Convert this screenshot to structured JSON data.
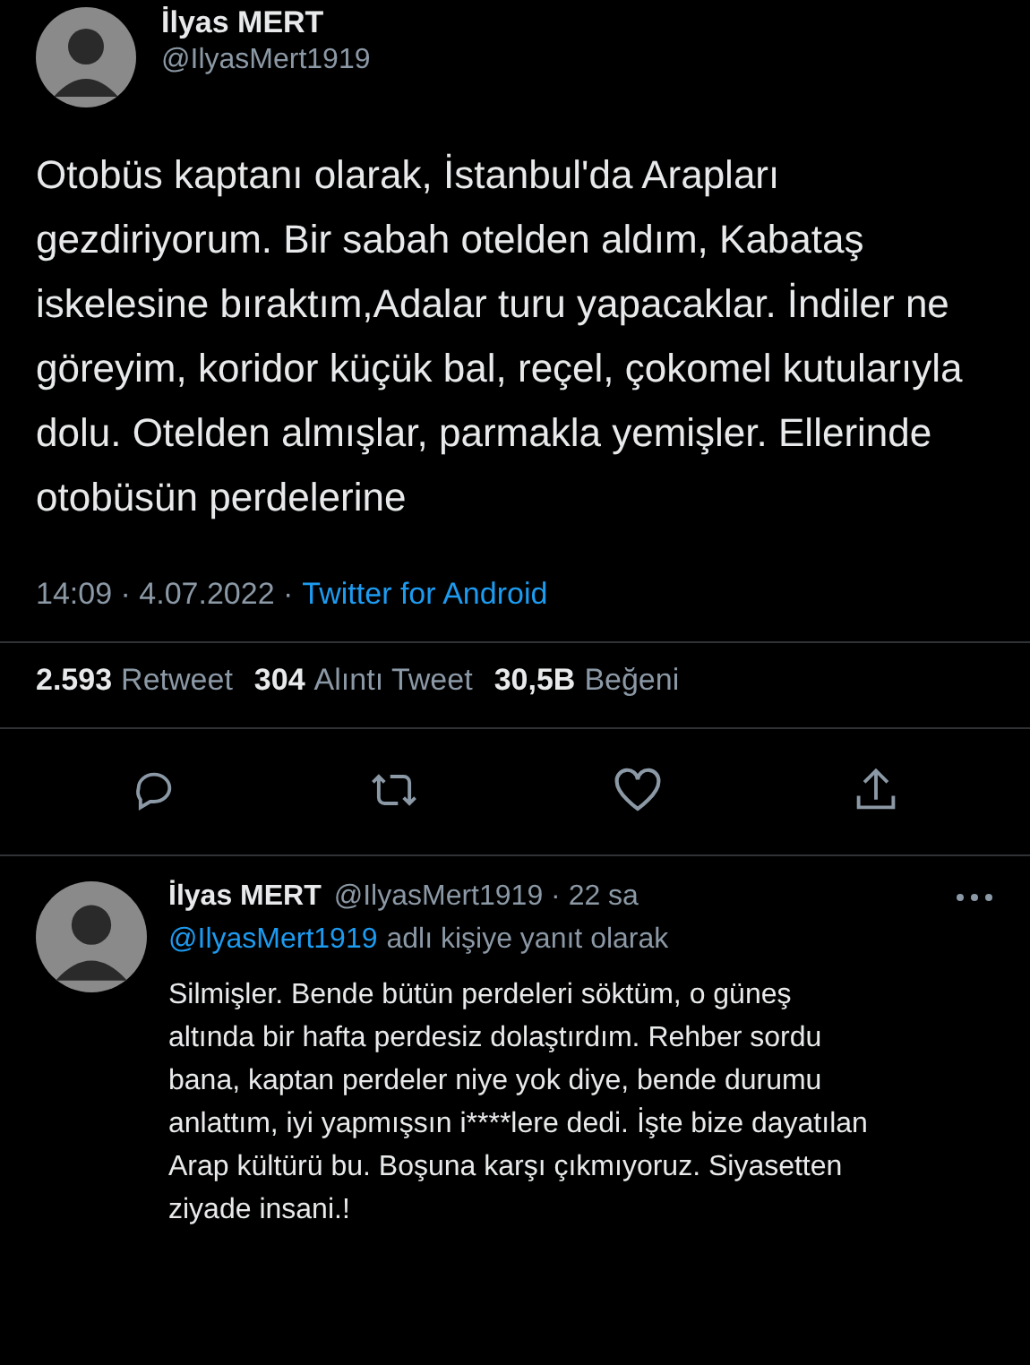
{
  "tweet": {
    "author": {
      "name": "İlyas MERT",
      "handle": "@IlyasMert1919"
    },
    "text": "Otobüs kaptanı olarak, İstanbul'da Arapları gezdiriyorum. Bir sabah otelden aldım, Kabataş iskelesine bıraktım,Adalar turu yapacaklar. İndiler ne göreyim, koridor küçük bal, reçel, çokomel kutularıyla dolu. Otelden almışlar, parmakla yemişler. Ellerinde otobüsün perdelerine",
    "timestamp": "14:09 · 4.07.2022 ·",
    "source": "Twitter for Android",
    "stats": [
      {
        "count": "2.593",
        "label": "Retweet"
      },
      {
        "count": "304",
        "label": "Alıntı Tweet"
      },
      {
        "count": "30,5B",
        "label": "Beğeni"
      }
    ],
    "actions": [
      {
        "kind": "reply"
      },
      {
        "kind": "retweet"
      },
      {
        "kind": "like"
      },
      {
        "kind": "share"
      }
    ]
  },
  "reply": {
    "author": {
      "name": "İlyas MERT",
      "handle": "@IlyasMert1919 · 22 sa"
    },
    "replying_to": {
      "mention": "@IlyasMert1919",
      "text": "adlı kişiye yanıt olarak"
    },
    "text": "Silmişler. Bende bütün perdeleri söktüm, o güneş altında bir hafta perdesiz dolaştırdım. Rehber sordu bana, kaptan perdeler niye yok diye, bende durumu anlattım, iyi yapmışsın i****lere dedi. İşte bize dayatılan Arap kültürü bu. Boşuna karşı çıkmıyoruz. Siyasetten ziyade insani.!"
  }
}
